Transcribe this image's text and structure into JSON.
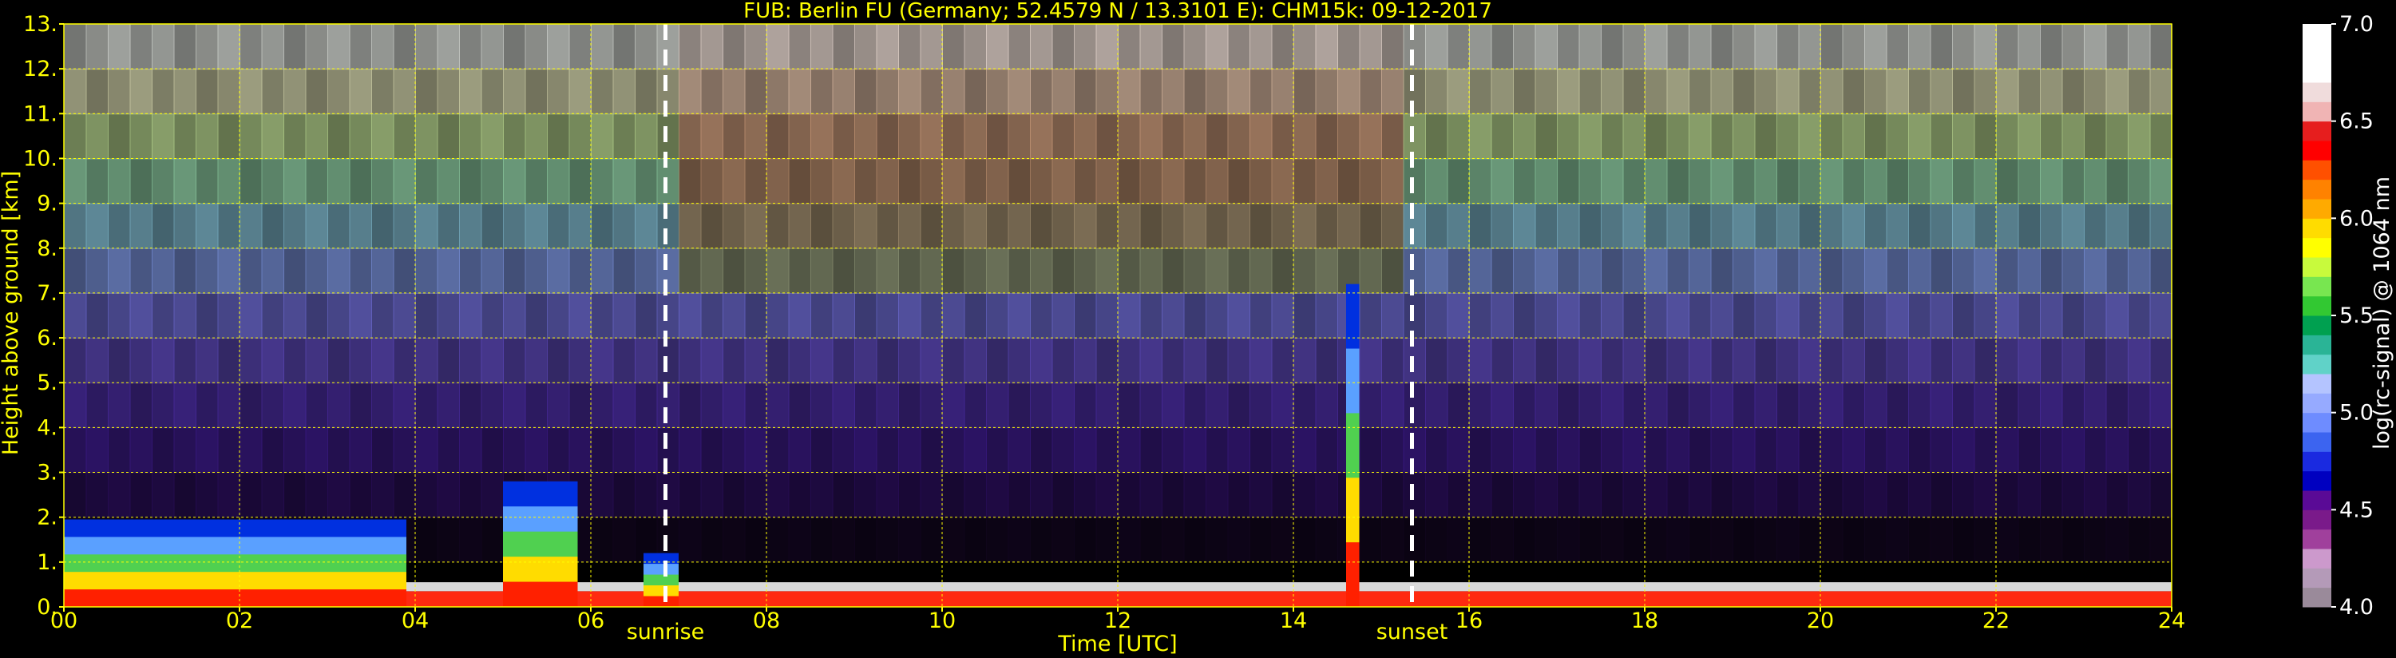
{
  "chart_data": {
    "type": "heatmap",
    "title": "FUB: Berlin FU (Germany; 52.4579 N / 13.3101 E):    CHM15k: 09-12-2017",
    "xlabel": "Time [UTC]",
    "ylabel": "Height above ground [km]",
    "xlim": [
      0,
      24
    ],
    "ylim": [
      0,
      13
    ],
    "xticks": [
      "00",
      "02",
      "04",
      "06",
      "08",
      "10",
      "12",
      "14",
      "16",
      "18",
      "20",
      "22",
      "24"
    ],
    "yticks": [
      "0.",
      "1.",
      "2.",
      "3.",
      "4.",
      "5.",
      "6.",
      "7.",
      "8.",
      "9.",
      "10.",
      "11.",
      "12.",
      "13."
    ],
    "grid": true,
    "markers": [
      {
        "label": "sunrise",
        "x": 6.85
      },
      {
        "label": "sunset",
        "x": 15.35
      }
    ],
    "colorbar": {
      "label": "log(rc-signal) @ 1064 nm",
      "range": [
        4.0,
        7.0
      ],
      "ticks": [
        "4.0",
        "4.5",
        "5.0",
        "5.5",
        "6.0",
        "6.5",
        "7.0"
      ],
      "colors": [
        "#9a8a9a",
        "#b49ab8",
        "#cc99cc",
        "#a0409c",
        "#7a1a8a",
        "#5a0a96",
        "#0000c0",
        "#1a2ae0",
        "#3c64f0",
        "#6e8cff",
        "#96aaff",
        "#b4c4ff",
        "#60d2c8",
        "#2ab496",
        "#00a050",
        "#32c832",
        "#78e650",
        "#c8fa3c",
        "#ffff00",
        "#ffdc00",
        "#ffaa00",
        "#ff8200",
        "#ff5000",
        "#ff0000",
        "#e61e1e",
        "#f0b4b4",
        "#f0dcdc",
        "#ffffff",
        "#ffffff",
        "#ffffff"
      ]
    },
    "cloud_layers": [
      {
        "start": 0.0,
        "end": 3.9,
        "top": 1.95
      },
      {
        "start": 5.0,
        "end": 5.85,
        "top": 2.8
      },
      {
        "start": 6.6,
        "end": 7.0,
        "top": 1.2
      },
      {
        "start": 14.6,
        "end": 14.75,
        "top": 7.2
      }
    ]
  }
}
